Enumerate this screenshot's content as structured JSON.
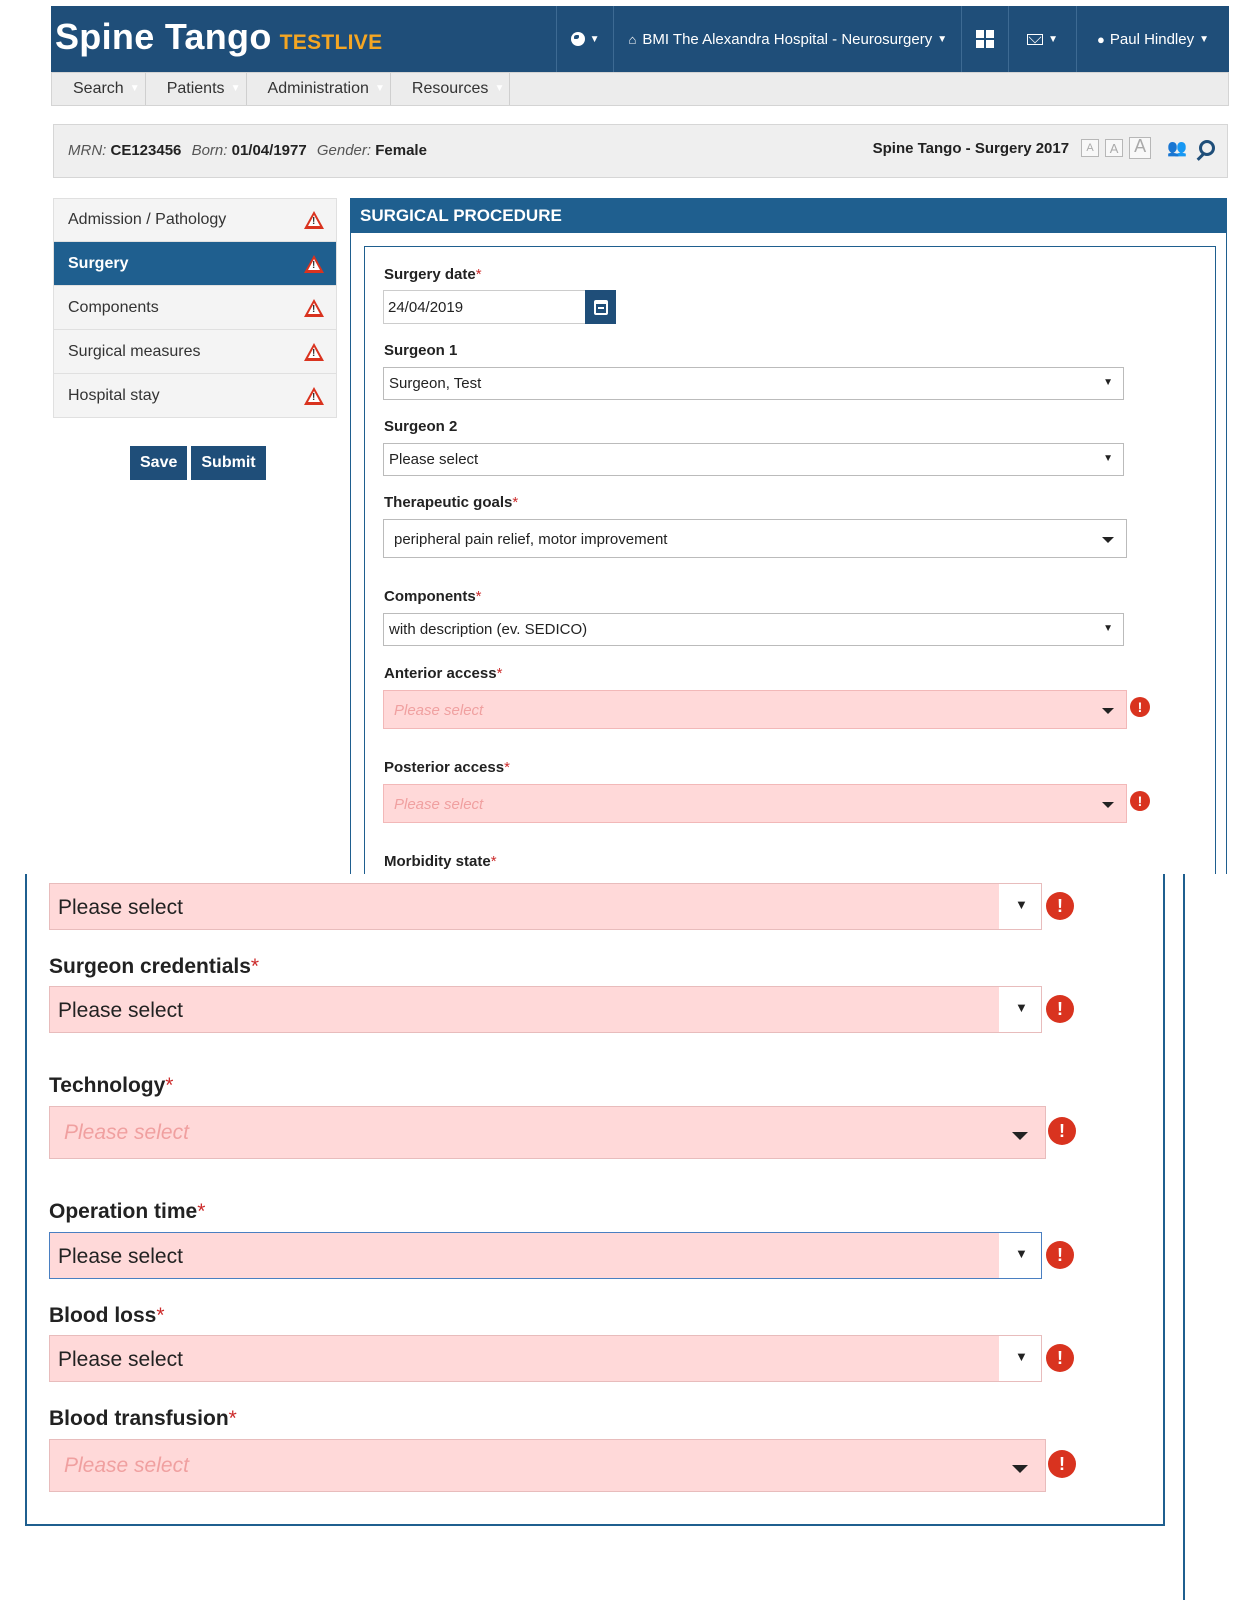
{
  "app": {
    "brand": "Spine Tango",
    "env": "TESTLIVE"
  },
  "topnav": {
    "org": "BMI The Alexandra Hospital - Neurosurgery",
    "user": "Paul Hindley"
  },
  "menu": [
    "Search",
    "Patients",
    "Administration",
    "Resources"
  ],
  "patient": {
    "mrn_label": "MRN:",
    "mrn": "CE123456",
    "born_label": "Born:",
    "born": "01/04/1977",
    "gender_label": "Gender:",
    "gender": "Female",
    "form_title": "Spine Tango - Surgery 2017",
    "font_sizes": [
      "A",
      "A",
      "A"
    ]
  },
  "sidebar": {
    "items": [
      {
        "label": "Admission / Pathology",
        "active": false
      },
      {
        "label": "Surgery",
        "active": true
      },
      {
        "label": "Components",
        "active": false
      },
      {
        "label": "Surgical measures",
        "active": false
      },
      {
        "label": "Hospital stay",
        "active": false
      }
    ],
    "save": "Save",
    "submit": "Submit"
  },
  "panel": {
    "title": "SURGICAL PROCEDURE",
    "required_mark": "*",
    "fields": {
      "surgery_date": {
        "label": "Surgery date",
        "value": "24/04/2019"
      },
      "surgeon1": {
        "label": "Surgeon 1",
        "value": "Surgeon, Test"
      },
      "surgeon2": {
        "label": "Surgeon 2",
        "value": "Please select"
      },
      "goals": {
        "label": "Therapeutic goals",
        "value": "peripheral pain relief, motor improvement"
      },
      "components": {
        "label": "Components",
        "value": "with description (ev. SEDICO)"
      },
      "anterior": {
        "label": "Anterior access",
        "placeholder": "Please select"
      },
      "posterior": {
        "label": "Posterior access",
        "placeholder": "Please select"
      },
      "morbidity": {
        "label": "Morbidity state"
      }
    }
  },
  "zoom": {
    "morbidity_value": "Please select",
    "surgeon_credentials": {
      "label": "Surgeon credentials",
      "value": "Please select"
    },
    "technology": {
      "label": "Technology",
      "placeholder": "Please select"
    },
    "operation_time": {
      "label": "Operation time",
      "value": "Please select"
    },
    "blood_loss": {
      "label": "Blood loss",
      "value": "Please select"
    },
    "blood_transfusion": {
      "label": "Blood transfusion",
      "placeholder": "Please select"
    }
  },
  "colors": {
    "primary": "#1f4e79",
    "accent": "#f5a623",
    "error": "#d9331f",
    "error_bg": "#ffd9d9"
  }
}
